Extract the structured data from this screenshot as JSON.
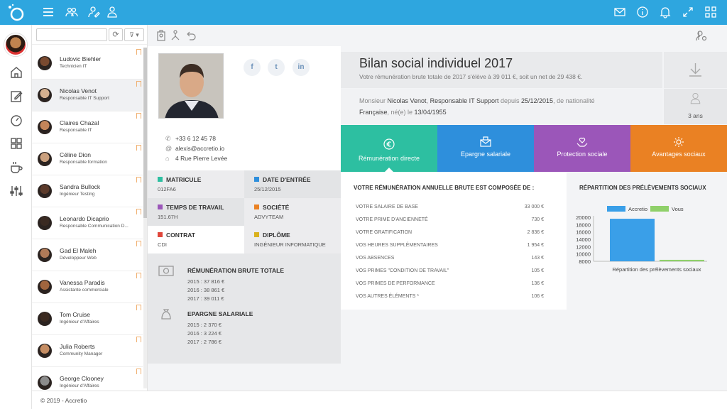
{
  "topbar": {
    "icons": [
      "menu-icon",
      "team-icon",
      "user-edit-icon",
      "user-icon",
      "mail-icon",
      "info-icon",
      "bell-icon",
      "fullscreen-icon",
      "grid-icon"
    ]
  },
  "rail": {
    "icons": [
      "home-icon",
      "edit-icon",
      "dashboard-icon",
      "apps-icon",
      "coffee-icon",
      "sliders-icon"
    ]
  },
  "employees": [
    {
      "name": "Ludovic Biehler",
      "role": "Technicien IT"
    },
    {
      "name": "Nicolas Venot",
      "role": "Responsable IT Support"
    },
    {
      "name": "Claires Chazal",
      "role": "Responsable IT"
    },
    {
      "name": "Céline Dion",
      "role": "Responsable formation"
    },
    {
      "name": "Sandra Bullock",
      "role": "Ingénieur Testing"
    },
    {
      "name": "Leonardo Dicaprio",
      "role": "Responsable Communication D..."
    },
    {
      "name": "Gad El Maleh",
      "role": "Développeur Web"
    },
    {
      "name": "Vanessa Paradis",
      "role": "Assistante commerciale"
    },
    {
      "name": "Tom Cruise",
      "role": "Ingénieur d'Affaires"
    },
    {
      "name": "Julia Roberts",
      "role": "Community Manager"
    },
    {
      "name": "George Clooney",
      "role": "Ingénieur d'Affaires"
    }
  ],
  "profile": {
    "phone": "+33 6 12 45 78",
    "email": "alexis@accretio.io",
    "address": "4 Rue Pierre Levée",
    "social": [
      "f",
      "t",
      "in"
    ]
  },
  "info": {
    "matricule_label": "MATRICULE",
    "matricule": "012FA6",
    "date_label": "DATE D'ENTRÉE",
    "date": "25/12/2015",
    "temps_label": "TEMPS DE TRAVAIL",
    "temps": "151.67H",
    "societe_label": "SOCIÉTÉ",
    "societe": "ADVYTEAM",
    "contrat_label": "CONTRAT",
    "contrat": "CDI",
    "diplome_label": "DIPLÔME",
    "diplome": "INGÉNIEUR INFORMATIQUE"
  },
  "totals": {
    "remu_title": "RÉMUNÉRATION BRUTE TOTALE",
    "remu": [
      "2015 : 37 816 €",
      "2016 : 38 861 €",
      "2017 : 39 011 €"
    ],
    "epargne_title": "EPARGNE SALARIALE",
    "epargne": [
      "2015 : 2 370 €",
      "2016 : 3 224 €",
      "2017 : 2 786 €"
    ]
  },
  "bilan": {
    "title": "Bilan social individuel 2017",
    "subtitle": "Votre rémunération brute totale de 2017 s'élève à 39 011 €, soit un net de 29 438 €.",
    "line1_a": "Monsieur ",
    "line1_name": "Nicolas Venot",
    "line1_b": ", ",
    "line1_role": "Responsable IT Support",
    "line1_c": " depuis ",
    "line1_date": "25/12/2015",
    "line1_d": ", de nationalité",
    "line2_nat": "Française",
    "line2_a": ", né(e) le ",
    "line2_date": "13/04/1955",
    "age": "3 ans"
  },
  "tabs": [
    {
      "label": "Rémunération directe",
      "color": "#2dbfa1"
    },
    {
      "label": "Epargne salariale",
      "color": "#2e8fdc"
    },
    {
      "label": "Protection sociale",
      "color": "#9b56b9"
    },
    {
      "label": "Avantages sociaux",
      "color": "#ea8123"
    }
  ],
  "breakdown": {
    "title": "VOTRE RÉMUNÉRATION ANNUELLE BRUTE EST COMPOSÉE DE :",
    "rows": [
      {
        "label": "VOTRE SALAIRE DE BASE",
        "value": "33 000 €"
      },
      {
        "label": "VOTRE PRIME D'ANCIENNETÉ",
        "value": "730 €"
      },
      {
        "label": "VOTRE GRATIFICATION",
        "value": "2 836 €"
      },
      {
        "label": "VOS HEURES SUPPLÉMENTAIRES",
        "value": "1 954 €"
      },
      {
        "label": "VOS ABSENCES",
        "value": "143 €"
      },
      {
        "label": "VOS PRIMES \"CONDITION DE TRAVAIL\"",
        "value": "105 €"
      },
      {
        "label": "VOS PRIMES DE PERFORMANCE",
        "value": "136 €"
      },
      {
        "label": "VOS AUTRES ÉLÉMENTS *",
        "value": "106 €"
      }
    ]
  },
  "chart_data": {
    "type": "bar",
    "title": "RÉPARTITION DES PRÉLÈVEMENTS SOCIAUX",
    "xlabel": "Répartition des prélèvements sociaux",
    "ylabel": "",
    "ylim": [
      8000,
      20000
    ],
    "yticks": [
      20000,
      18000,
      16000,
      14000,
      12000,
      10000,
      8000
    ],
    "legend_position": "top",
    "series": [
      {
        "name": "Accretio",
        "value": 19600,
        "color": "#3a9fe8"
      },
      {
        "name": "Vous",
        "value": 8400,
        "color": "#8fd06a"
      }
    ]
  },
  "footer": "© 2019 - Accretio"
}
